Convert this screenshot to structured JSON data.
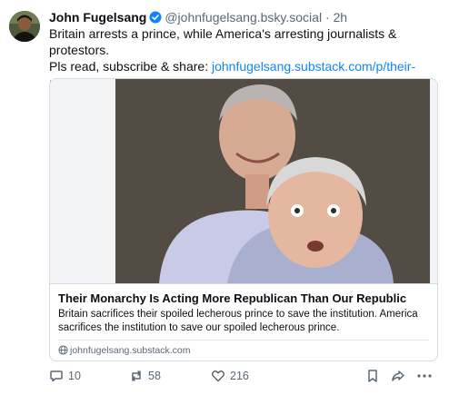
{
  "post": {
    "author_name": "John Fugelsang",
    "handle": "@johnfugelsang.bsky.social",
    "separator": "·",
    "time": "2h",
    "text_line1": "Britain arrests a prince, while America's arresting journalists & protestors.",
    "text_line2_prefix": "Pls read, subscribe & share: ",
    "link_text": "johnfugelsang.substack.com/p/their-mona..."
  },
  "link_card": {
    "title": "Their Monarchy Is Acting More Republican Than Our Republic",
    "description": "Britain sacrifices their spoiled lecherous prince to save the institution. America sacrifices the institution to save our spoiled lecherous prince.",
    "domain": "johnfugelsang.substack.com"
  },
  "actions": {
    "replies": "10",
    "reposts": "58",
    "likes": "216"
  },
  "icons": {
    "verified": "verified-badge-icon",
    "globe": "globe-icon",
    "reply": "reply-icon",
    "repost": "repost-icon",
    "like": "heart-icon",
    "bookmark": "bookmark-icon",
    "share": "share-icon",
    "more": "more-icon"
  },
  "colors": {
    "link": "#1083fe",
    "verified": "#1083fe",
    "muted": "#5b6775",
    "border": "#d4dbe2"
  }
}
